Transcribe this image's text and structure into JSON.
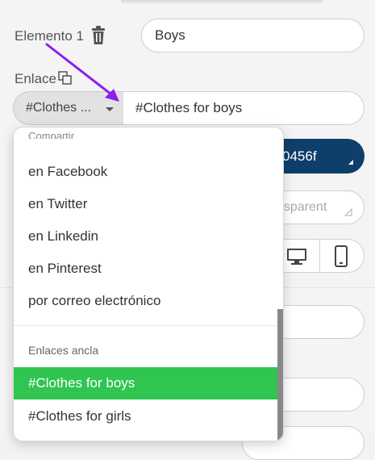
{
  "element": {
    "label": "Elemento 1",
    "value": "Boys"
  },
  "link": {
    "label": "Enlace",
    "selected_option": "#Clothes ...",
    "value": "#Clothes for boys"
  },
  "color_value": "0456f",
  "background_value": "nsparent",
  "dropdown": {
    "share_header": "Compartir",
    "share_items": [
      "en Facebook",
      "en Twitter",
      "en Linkedin",
      "en Pinterest",
      "por correo electrónico"
    ],
    "anchor_header": "Enlaces ancla",
    "anchor_items": [
      "#Clothes for boys",
      "#Clothes for girls"
    ]
  },
  "colors": {
    "accent_green": "#2fc550",
    "navy": "#0e3f6a",
    "arrow_purple": "#8a1ff0"
  },
  "icons": [
    "trash-icon",
    "copy-link-icon",
    "chevron-down-icon",
    "desktop-icon",
    "mobile-icon",
    "resize-corner-icon"
  ]
}
